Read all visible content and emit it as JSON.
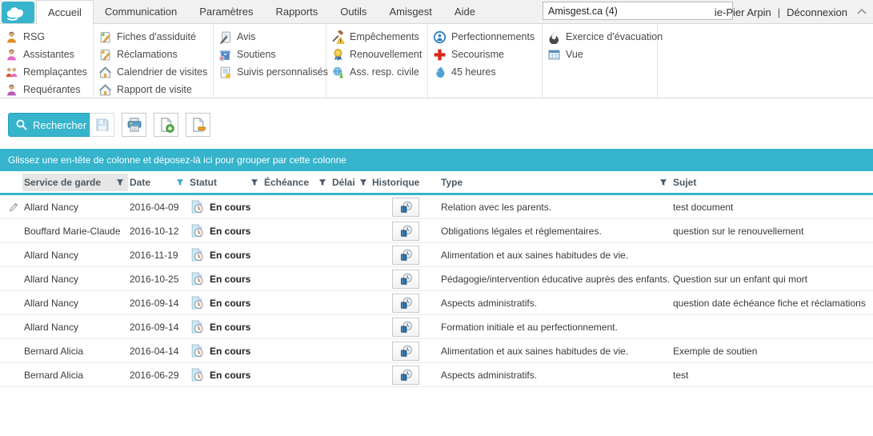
{
  "colors": {
    "accent": "#35b4cc",
    "header_text": "#4a5a66",
    "filter_active": "#35a9cc",
    "filter_default": "#46586a"
  },
  "topbar": {
    "account": "Amisgest.ca (4)",
    "user": "ie-Pier Arpin",
    "separator": "|",
    "logout": "Déconnexion"
  },
  "tabs": {
    "active": "Accueil",
    "items": [
      "Accueil",
      "Communication",
      "Paramètres",
      "Rapports",
      "Outils",
      "Amisgest",
      "Aide"
    ]
  },
  "ribbon": {
    "groups": [
      {
        "items": [
          {
            "icon": "person-orange",
            "label": "RSG"
          },
          {
            "icon": "person-pink",
            "label": "Assistantes"
          },
          {
            "icon": "people-pair",
            "label": "Remplaçantes"
          },
          {
            "icon": "person-purple",
            "label": "Requérantes"
          }
        ]
      },
      {
        "items": [
          {
            "icon": "card-green-pencil",
            "label": "Fiches d'assiduité"
          },
          {
            "icon": "card-orange-pencil",
            "label": "Réclamations"
          },
          {
            "icon": "house",
            "label": "Calendrier de visites"
          },
          {
            "icon": "house",
            "label": "Rapport de visite"
          }
        ]
      },
      {
        "items": [
          {
            "icon": "page-pen",
            "label": "Avis"
          },
          {
            "icon": "box-support",
            "label": "Soutiens"
          },
          {
            "icon": "list-star",
            "label": "Suivis personnalisés"
          }
        ]
      },
      {
        "items": [
          {
            "icon": "gavel-warning",
            "label": "Empêchements"
          },
          {
            "icon": "medal",
            "label": "Renouvellement"
          },
          {
            "icon": "globe-person",
            "label": "Ass. resp. civile"
          }
        ]
      },
      {
        "items": [
          {
            "icon": "badge-training",
            "label": "Perfectionnements"
          },
          {
            "icon": "red-cross",
            "label": "Secourisme"
          },
          {
            "icon": "droplet",
            "label": "45 heures"
          }
        ]
      },
      {
        "items": [
          {
            "icon": "flame",
            "label": "Exercice d'évacuation"
          },
          {
            "icon": "grid-view",
            "label": "Vue"
          }
        ]
      }
    ]
  },
  "toolbar": {
    "search_label": "Rechercher",
    "buttons": [
      {
        "name": "save-button",
        "icon": "save-icon",
        "disabled": true
      },
      {
        "name": "print-button",
        "icon": "print-icon",
        "disabled": false
      },
      {
        "name": "add-record-button",
        "icon": "page-plus-icon",
        "disabled": false
      },
      {
        "name": "remove-record-button",
        "icon": "page-minus-icon",
        "disabled": false
      }
    ]
  },
  "grid": {
    "group_hint": "Glissez une en-tête de colonne et déposez-là ici pour grouper par cette colonne",
    "columns": [
      {
        "label": "Service de garde",
        "filter": "default",
        "highlight": true
      },
      {
        "label": "Date",
        "filter": "active"
      },
      {
        "label": "Statut",
        "filter": "default"
      },
      {
        "label": "Échéance",
        "filter": "default"
      },
      {
        "label": "Délai",
        "filter": "default"
      },
      {
        "label": "Historique"
      },
      {
        "label": "Type",
        "filter": "default"
      },
      {
        "label": "Sujet"
      }
    ],
    "rows": [
      {
        "editing": true,
        "service": "Allard Nancy",
        "date": "2016-04-09",
        "statut": "En cours",
        "echeance": "",
        "delai": "",
        "type": "Relation avec les parents.",
        "sujet": "test document"
      },
      {
        "editing": false,
        "service": "Bouffard Marie-Claude",
        "date": "2016-10-12",
        "statut": "En cours",
        "echeance": "",
        "delai": "",
        "type": "Obligations légales et réglementaires.",
        "sujet": "question sur le renouvellement"
      },
      {
        "editing": false,
        "service": "Allard Nancy",
        "date": "2016-11-19",
        "statut": "En cours",
        "echeance": "",
        "delai": "",
        "type": "Alimentation et aux saines habitudes de vie.",
        "sujet": ""
      },
      {
        "editing": false,
        "service": "Allard Nancy",
        "date": "2016-10-25",
        "statut": "En cours",
        "echeance": "",
        "delai": "",
        "type": "Pédagogie/intervention éducative auprès des enfants.",
        "sujet": "Question sur un enfant qui mort"
      },
      {
        "editing": false,
        "service": "Allard Nancy",
        "date": "2016-09-14",
        "statut": "En cours",
        "echeance": "",
        "delai": "",
        "type": "Aspects administratifs.",
        "sujet": "question date échéance fiche et réclamations"
      },
      {
        "editing": false,
        "service": "Allard Nancy",
        "date": "2016-09-14",
        "statut": "En cours",
        "echeance": "",
        "delai": "",
        "type": "Formation initiale et au perfectionnement.",
        "sujet": ""
      },
      {
        "editing": false,
        "service": "Bernard Alicia",
        "date": "2016-04-14",
        "statut": "En cours",
        "echeance": "",
        "delai": "",
        "type": "Alimentation et aux saines habitudes de vie.",
        "sujet": "Exemple de soutien"
      },
      {
        "editing": false,
        "service": "Bernard Alicia",
        "date": "2016-06-29",
        "statut": "En cours",
        "echeance": "",
        "delai": "",
        "type": "Aspects administratifs.",
        "sujet": "test"
      }
    ]
  }
}
